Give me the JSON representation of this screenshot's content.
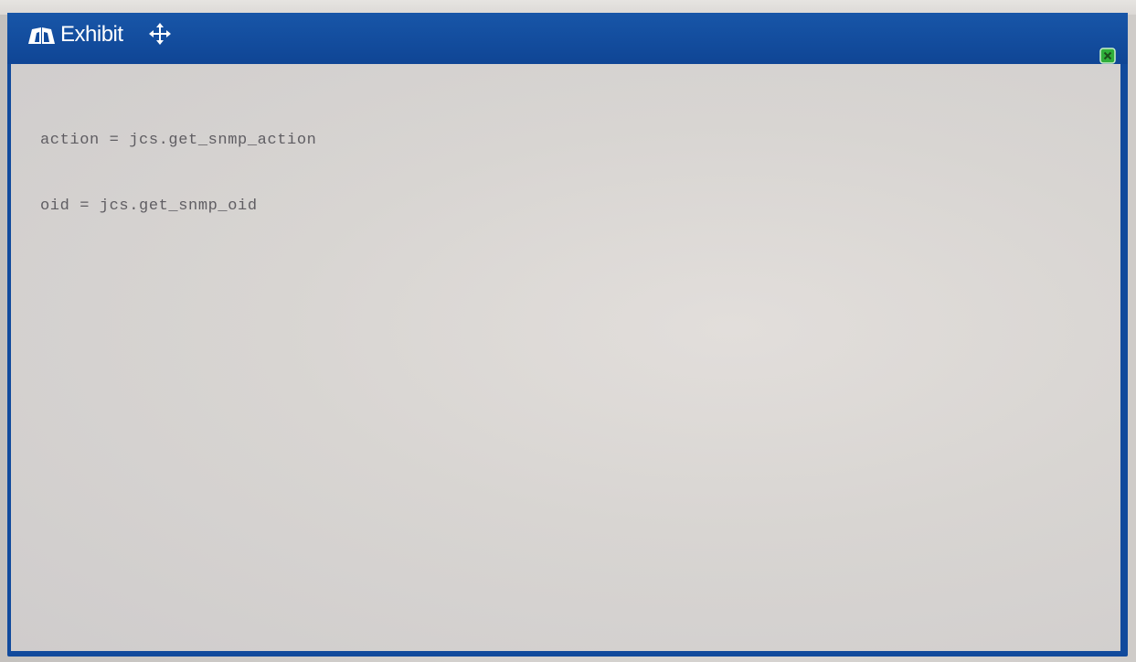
{
  "window": {
    "title": "Exhibit",
    "title_icon": "exhibit-book-icon",
    "move_icon": "move-arrows-icon",
    "close_icon": "close-icon",
    "accent_color": "#114a9c",
    "close_color": "#2fae3a"
  },
  "code": {
    "lines": [
      "action = jcs.get_snmp_action",
      "oid = jcs.get_snmp_oid"
    ]
  }
}
